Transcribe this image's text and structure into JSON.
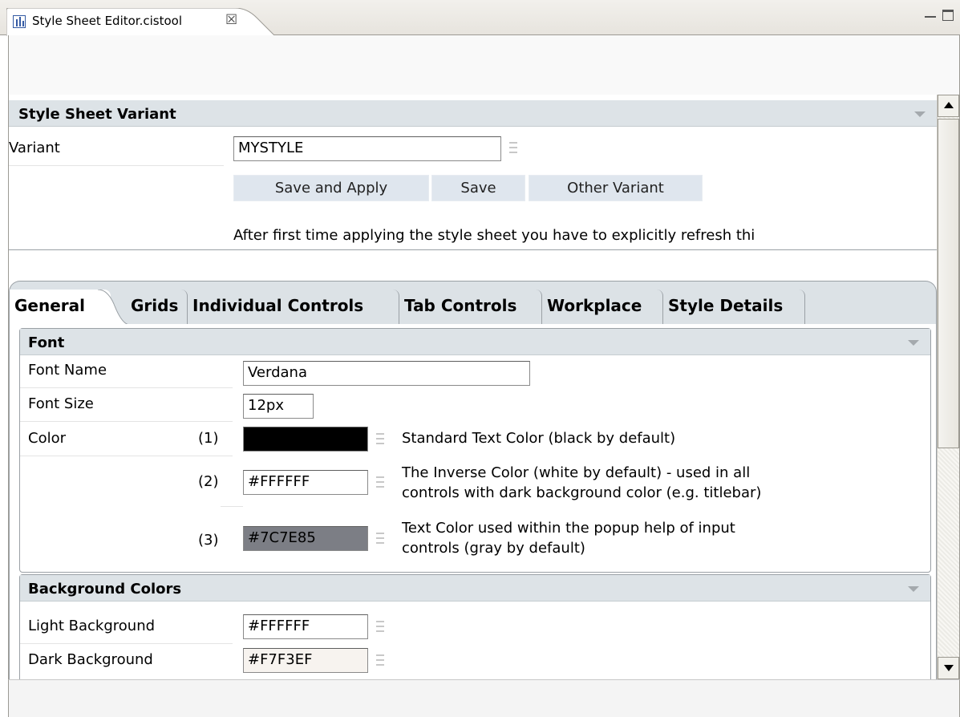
{
  "editor_tab": {
    "title": "Style Sheet Editor.cistool"
  },
  "variant_section": {
    "title": "Style Sheet Variant",
    "variant_label": "Variant",
    "variant_value": "MYSTYLE",
    "buttons": {
      "save_apply": "Save and Apply",
      "save": "Save",
      "other_variant": "Other Variant"
    },
    "hint": "After first time applying the style sheet you have to explicitly refresh thi"
  },
  "tabs": [
    "General",
    "Grids",
    "Individual Controls",
    "Tab Controls",
    "Workplace",
    "Style Details"
  ],
  "font_group": {
    "title": "Font",
    "font_name_label": "Font Name",
    "font_name_value": "Verdana",
    "font_size_label": "Font Size",
    "font_size_value": "12px",
    "color_label": "Color",
    "colors": [
      {
        "index": "(1)",
        "value": "",
        "swatch": "#000000",
        "desc1": "Standard Text Color (black by default)",
        "desc2": ""
      },
      {
        "index": "(2)",
        "value": "#FFFFFF",
        "swatch": "#FFFFFF",
        "desc1": "The Inverse Color (white by default) - used in all",
        "desc2": "controls with dark background color (e.g. titlebar)"
      },
      {
        "index": "(3)",
        "value": "#7C7E85",
        "swatch": "#7C7E85",
        "desc1": "Text Color used within the popup help of input",
        "desc2": "controls (gray by default)"
      }
    ]
  },
  "background_group": {
    "title": "Background Colors",
    "light_label": "Light Background",
    "light_value": "#FFFFFF",
    "dark_label": "Dark Background",
    "dark_value": "#F7F3EF"
  },
  "colors": {
    "header_bg": "#dde3e7",
    "button_bg": "#dfe6ee",
    "tab_bg": "#dce2e6"
  }
}
